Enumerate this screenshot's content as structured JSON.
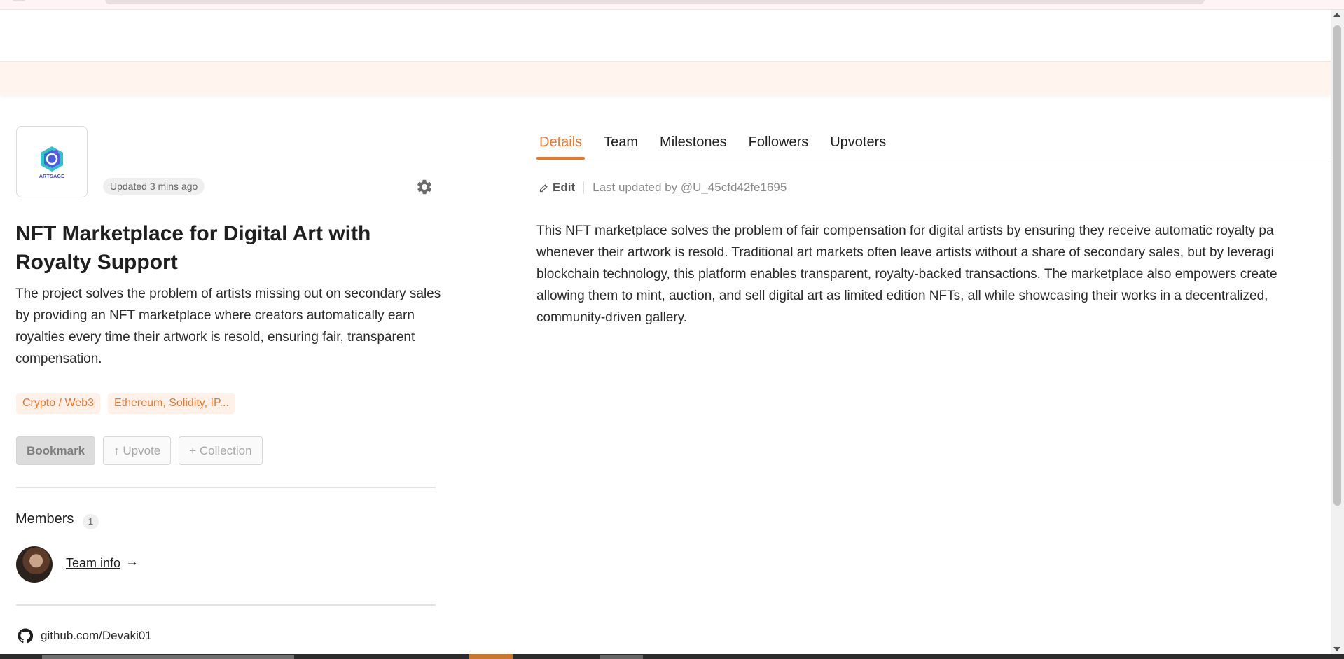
{
  "project": {
    "logo_text": "ARTSAGE",
    "updated": "Updated 3 mins ago",
    "title": "NFT Marketplace for Digital Art with Royalty Support",
    "summary": "The project solves the problem of artists missing out on secondary sales by providing an NFT marketplace where creators automatically earn royalties every time their artwork is resold, ensuring fair, transparent compensation.",
    "tags": [
      "Crypto / Web3",
      "Ethereum, Solidity, IP..."
    ]
  },
  "actions": {
    "bookmark": "Bookmark",
    "upvote": "↑ Upvote",
    "collection": "+ Collection"
  },
  "members": {
    "title": "Members",
    "count": "1",
    "team_link": "Team info",
    "arrow": "→"
  },
  "github": {
    "label": "github.com/Devaki01"
  },
  "tabs": [
    "Details",
    "Team",
    "Milestones",
    "Followers",
    "Upvoters"
  ],
  "active_tab": "Details",
  "details": {
    "edit_label": "Edit",
    "last_updated": "Last updated by @U_45cfd42fe1695",
    "lines": [
      "This NFT marketplace solves the problem of fair compensation for digital artists by ensuring they receive automatic royalty pa",
      "whenever their artwork is resold. Traditional art markets often leave artists without a share of secondary sales, but by leveragi",
      "blockchain technology, this platform enables transparent, royalty-backed transactions. The marketplace also empowers create",
      "allowing them to mint, auction, and sell digital art as limited edition NFTs, all while showcasing their works in a decentralized,",
      "community-driven gallery."
    ]
  },
  "colors": {
    "accent": "#e8772e",
    "tag_bg": "#fff1e8",
    "banner_bg": "#fff4ee"
  }
}
